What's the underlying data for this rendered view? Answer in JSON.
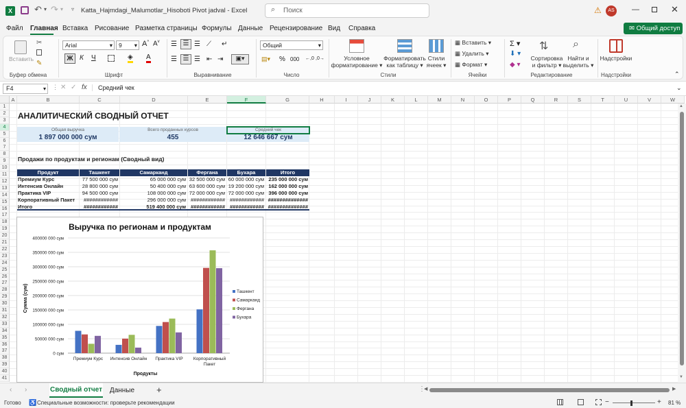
{
  "window": {
    "filename": "Katta_Hajmdagi_Malumotlar_Hisoboti Pivot jadval",
    "app": "Excel",
    "title_sep": "-",
    "search_placeholder": "Поиск",
    "user_initials": "AS"
  },
  "menu": {
    "tabs": [
      "Файл",
      "Главная",
      "Вставка",
      "Рисование",
      "Разметка страницы",
      "Формулы",
      "Данные",
      "Рецензирование",
      "Вид",
      "Справка"
    ],
    "active": "Главная",
    "share_label": "Общий доступ"
  },
  "ribbon": {
    "paste_label": "Вставить",
    "clipboard_group": "Буфер обмена",
    "font_name": "Arial",
    "font_size": "9",
    "font_group": "Шрифт",
    "bold": "Ж",
    "italic": "К",
    "underline": "Ч",
    "align_group": "Выравнивание",
    "number_format": "Общий",
    "number_group": "Число",
    "cond_format_1": "Условное",
    "cond_format_2": "форматирование",
    "format_table_1": "Форматировать",
    "format_table_2": "как таблицу",
    "cell_styles_1": "Стили",
    "cell_styles_2": "ячеек",
    "styles_group": "Стили",
    "insert_cells": "Вставить",
    "delete_cells": "Удалить",
    "format_cells": "Формат",
    "cells_group": "Ячейки",
    "sort_1": "Сортировка",
    "sort_2": "и фильтр",
    "find_1": "Найти и",
    "find_2": "выделить",
    "editing_group": "Редактирование",
    "addins": "Надстройки",
    "addins_group": "Надстройки"
  },
  "formula_bar": {
    "name_box": "F4",
    "formula": "Средний чек"
  },
  "columns": [
    "A",
    "B",
    "C",
    "D",
    "E",
    "F",
    "G",
    "H",
    "I",
    "J",
    "K",
    "L",
    "M",
    "N",
    "O",
    "P",
    "Q",
    "R",
    "S",
    "T",
    "U",
    "V",
    "W"
  ],
  "rows": [
    "1",
    "2",
    "3",
    "4",
    "5",
    "6",
    "7",
    "8",
    "9",
    "10",
    "11",
    "12",
    "13",
    "14",
    "15",
    "16",
    "17",
    "18",
    "19",
    "20",
    "21",
    "22",
    "23",
    "24",
    "25",
    "26",
    "27",
    "28",
    "29",
    "30",
    "31",
    "32",
    "33",
    "34",
    "35",
    "36",
    "37",
    "38",
    "39",
    "40",
    "41"
  ],
  "sheet": {
    "title": "АНАЛИТИЧЕСКИЙ СВОДНЫЙ ОТЧЕТ",
    "kpi": [
      {
        "label": "Общая выручка",
        "value": "1 897 000 000 сум"
      },
      {
        "label": "Всего проданных курсов",
        "value": "455"
      },
      {
        "label": "Средний чек",
        "value": "12 646 667 сум"
      }
    ],
    "section_title": "Продажи по продуктам и регионам (Сводный вид)",
    "table_headers": [
      "Продукт",
      "Ташкент",
      "Самарканд",
      "Фергана",
      "Бухара",
      "Итого"
    ],
    "table_rows": [
      [
        "Премиум Курс",
        "77 500 000 сум",
        "65 000 000 сум",
        "32 500 000 сум",
        "60 000 000 сум",
        "235 000 000 сум"
      ],
      [
        "Интенсив Онлайн",
        "28 800 000 сум",
        "50 400 000 сум",
        "63 600 000 сум",
        "19 200 000 сум",
        "162 000 000 сум"
      ],
      [
        "Практика VIP",
        "94 500 000 сум",
        "108 000 000 сум",
        "72 000 000 сум",
        "72 000 000 сум",
        "396 000 000 сум"
      ],
      [
        "Корпоративный Пакет",
        "############",
        "296 000 000 сум",
        "############",
        "############",
        "##############"
      ],
      [
        "Итого",
        "############",
        "519 400 000 сум",
        "############",
        "############",
        "##############"
      ]
    ]
  },
  "chart_data": {
    "type": "bar",
    "title": "Выручка по регионам и продуктам",
    "xlabel": "Продукты",
    "ylabel": "Сумма (сум)",
    "categories": [
      "Премиум Курс",
      "Интенсив Онлайн",
      "Практика VIP",
      "Корпоративный Пакет"
    ],
    "ylim": [
      0,
      400000000
    ],
    "ytick_labels": [
      "0 сум",
      "50000 000 сум",
      "100000 000 сум",
      "150000 000 сум",
      "200000 000 сум",
      "250000 000 сум",
      "300000 000 сум",
      "350000 000 сум",
      "400000 000 сум"
    ],
    "series": [
      {
        "name": "Ташкент",
        "color": "#4472c4",
        "values": [
          77500000,
          28800000,
          94500000,
          152000000
        ]
      },
      {
        "name": "Самарканд",
        "color": "#c0504d",
        "values": [
          65000000,
          50400000,
          108000000,
          296000000
        ]
      },
      {
        "name": "Фергана",
        "color": "#9bbb59",
        "values": [
          32500000,
          63600000,
          120000000,
          357000000
        ]
      },
      {
        "name": "Бухара",
        "color": "#8064a2",
        "values": [
          60000000,
          19200000,
          72000000,
          295000000
        ]
      }
    ],
    "legend_position": "right",
    "grid": true
  },
  "tabs": {
    "sheets": [
      "Сводный отчет",
      "Данные"
    ],
    "active": "Сводный отчет",
    "add": "+"
  },
  "status": {
    "ready": "Готово",
    "accessibility": "Специальные возможности: проверьте рекомендации",
    "zoom": "81 %"
  },
  "colors": {
    "accent": "#107c41",
    "header_navy": "#203764",
    "kpi_fill": "#ddebf7"
  }
}
